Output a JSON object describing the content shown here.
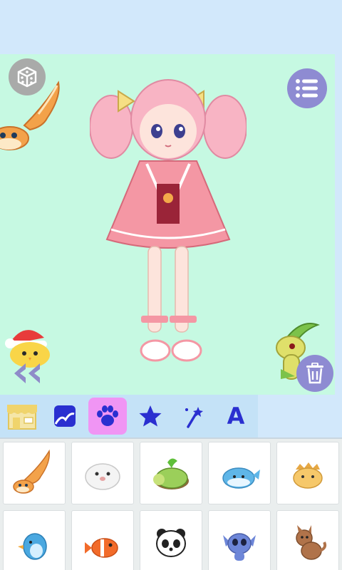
{
  "canvas": {
    "background_color": "#c6f9e2",
    "character": "pink-haired-kimono-doll",
    "pets_on_canvas": [
      "flying-fox-pet",
      "santa-chick-pet",
      "leaf-dino-pet"
    ]
  },
  "buttons": {
    "random_icon": "dice-icon",
    "menu_icon": "list-icon",
    "delete_icon": "trash-icon",
    "back_icon": "double-chevron-left-icon"
  },
  "toolbar": {
    "tabs": [
      {
        "name": "shop",
        "icon": "shop-icon",
        "active": false
      },
      {
        "name": "background",
        "icon": "picture-icon",
        "active": false
      },
      {
        "name": "pets",
        "icon": "paw-icon",
        "active": true
      },
      {
        "name": "stickers",
        "icon": "star-icon",
        "active": false
      },
      {
        "name": "effects",
        "icon": "magic-wand-icon",
        "active": false
      },
      {
        "name": "text",
        "icon": "letter-a-icon",
        "active": false,
        "label": "A"
      }
    ]
  },
  "pets_grid": {
    "items": [
      {
        "name": "flying-fox",
        "color": "#f3a24a"
      },
      {
        "name": "white-seal",
        "color": "#eeeeee"
      },
      {
        "name": "leaf-turtle",
        "color": "#9bcf5a"
      },
      {
        "name": "blue-whale",
        "color": "#5fb6e8"
      },
      {
        "name": "spiky-hamster",
        "color": "#f6c86a"
      },
      {
        "name": "blue-bird",
        "color": "#4aa8e0"
      },
      {
        "name": "clownfish",
        "color": "#f26b2a"
      },
      {
        "name": "panda",
        "color": "#222222"
      },
      {
        "name": "blue-koala",
        "color": "#6d86d8"
      },
      {
        "name": "brown-puppy",
        "color": "#b0734a"
      }
    ]
  },
  "colors": {
    "accent": "#8e8bd2",
    "tab_icon": "#2a2fd0",
    "active_tab": "#f095f4",
    "toolbar": "#c4e2f7"
  }
}
